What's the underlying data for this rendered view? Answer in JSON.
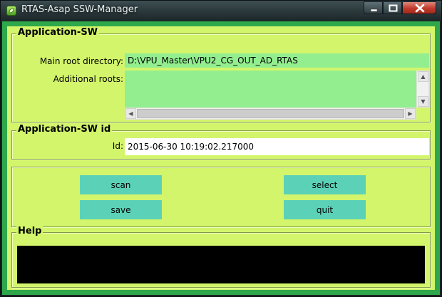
{
  "window": {
    "title": "RTAS-Asap SSW-Manager",
    "icon": "leaf-app-icon",
    "controls": {
      "minimize": "minimize-icon",
      "maximize": "maximize-icon",
      "close": "close-icon"
    }
  },
  "app_sw": {
    "legend": "Application-SW",
    "main_root_label": "Main root directory:",
    "main_root_value": "D:\\VPU_Master\\VPU2_CG_OUT_AD_RTAS",
    "additional_roots_label": "Additional roots:",
    "additional_roots_value": ""
  },
  "app_sw_id": {
    "legend": "Application-SW id",
    "id_label": "Id:",
    "id_value": "2015-06-30 10:19:02.217000"
  },
  "actions": {
    "scan": "scan",
    "select": "select",
    "save": "save",
    "quit": "quit"
  },
  "help": {
    "legend": "Help",
    "text": ""
  },
  "colors": {
    "client_bg": "#d3f56b",
    "frame_border": "#2ea84a",
    "field_green": "#93ee8f",
    "button_teal": "#5bd2b7",
    "help_bg": "#000000"
  }
}
